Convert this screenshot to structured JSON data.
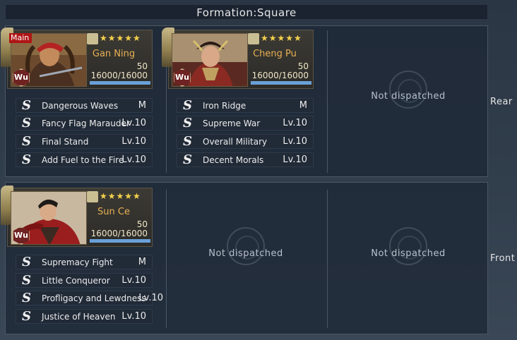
{
  "formation": {
    "title": "Formation:Square"
  },
  "rows": {
    "rear_label": "Rear",
    "front_label": "Front"
  },
  "generals": [
    {
      "name": "Gan Ning",
      "main_badge": "Main",
      "faction": "Wu",
      "stars": "★★★★★",
      "level": "50",
      "troops": "16000/16000",
      "hp_fraction": 1.0,
      "skills": [
        {
          "name": "Dangerous Waves",
          "level": "M"
        },
        {
          "name": "Fancy Flag Marauder",
          "level": "Lv.10"
        },
        {
          "name": "Final Stand",
          "level": "Lv.10"
        },
        {
          "name": "Add Fuel to the Fire",
          "level": "Lv.10"
        }
      ]
    },
    {
      "name": "Cheng Pu",
      "faction": "Wu",
      "stars": "★★★★★",
      "level": "50",
      "troops": "16000/16000",
      "hp_fraction": 1.0,
      "skills": [
        {
          "name": "Iron Ridge",
          "level": "M"
        },
        {
          "name": "Supreme War",
          "level": "Lv.10"
        },
        {
          "name": "Overall Military",
          "level": "Lv.10"
        },
        {
          "name": "Decent Morals",
          "level": "Lv.10"
        }
      ]
    },
    {
      "name": "Sun Ce",
      "faction": "Wu",
      "stars": "★★★★★",
      "level": "50",
      "troops": "16000/16000",
      "hp_fraction": 1.0,
      "skills": [
        {
          "name": "Supremacy Fight",
          "level": "M"
        },
        {
          "name": "Little Conqueror",
          "level": "Lv.10"
        },
        {
          "name": "Profligacy and Lewdness",
          "level": "Lv.10"
        },
        {
          "name": "Justice of Heaven",
          "level": "Lv.10"
        }
      ]
    }
  ],
  "empty_slots": {
    "rear_right": "Not dispatched",
    "front_middle": "Not dispatched",
    "front_right": "Not dispatched"
  },
  "icons": {
    "skill": "S",
    "tactic_icons": [
      "crossed-swords-icon",
      "helmet-icon",
      "fist-icon"
    ]
  },
  "colors": {
    "name_gold": "#e8b054",
    "star_yellow": "#f4d24c",
    "faction_red": "#6f2222",
    "main_red": "#b01515",
    "hp_blue": "#6aa0d8"
  }
}
